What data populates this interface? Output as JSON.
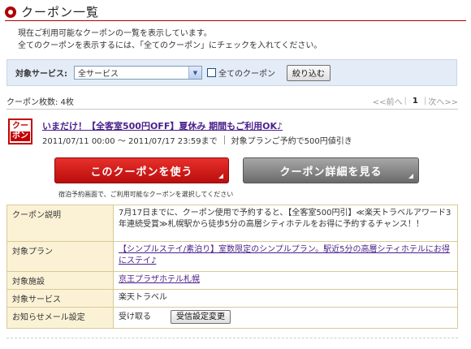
{
  "header": {
    "title": "クーポン一覧"
  },
  "intro": {
    "line1": "現在ご利用可能なクーポンの一覧を表示しています。",
    "line2": "全てのクーポンを表示するには、「全てのクーポン」にチェックを入れてください。"
  },
  "filter": {
    "label": "対象サービス:",
    "selected": "全サービス",
    "all_coupons_label": "全てのクーポン",
    "narrow_button": "絞り込む"
  },
  "summary": {
    "count_text": "クーポン枚数: 4枚"
  },
  "pager": {
    "prev": "<<前へ",
    "current": "1",
    "next": "次へ>>"
  },
  "coupon": {
    "badge_top": "クー",
    "badge_bottom": "ポン",
    "title": "いまだけ！【全客室500円OFF】夏休み 期間もご利用OK♪",
    "period": "2011/07/11 00:00 ～ 2011/07/17 23:59まで",
    "discount": "対象プランご予約で500円値引き",
    "use_button": "このクーポンを使う",
    "detail_button": "クーポン詳細を見る",
    "note": "宿泊予約画面で、ご利用可能なクーポンを選択してください"
  },
  "details": {
    "desc_label": "クーポン説明",
    "desc_value": "7月17日までに、クーポン使用で予約すると、【全客室500円引】≪楽天トラベルアワード3年連続受賞≫札幌駅から徒歩5分の高層シティホテルをお得に予約するチャンス！！",
    "plan_label": "対象プラン",
    "plan_value": "【シンプルステイ/素泊り】室数限定のシンプルプラン。駅近5分の高層シティホテルにお得にステイ♪",
    "facility_label": "対象施設",
    "facility_value": "京王プラザホテル札幌",
    "service_label": "対象サービス",
    "service_value": "楽天トラベル",
    "mail_label": "お知らせメール設定",
    "mail_value": "受け取る",
    "mail_button": "受信設定変更"
  },
  "colors": {
    "accent": "#b00000",
    "use_button": "#d11f1a",
    "detail_button": "#8a8a8a",
    "table_header": "#fbf2d6",
    "link": "#4a1f8a"
  }
}
